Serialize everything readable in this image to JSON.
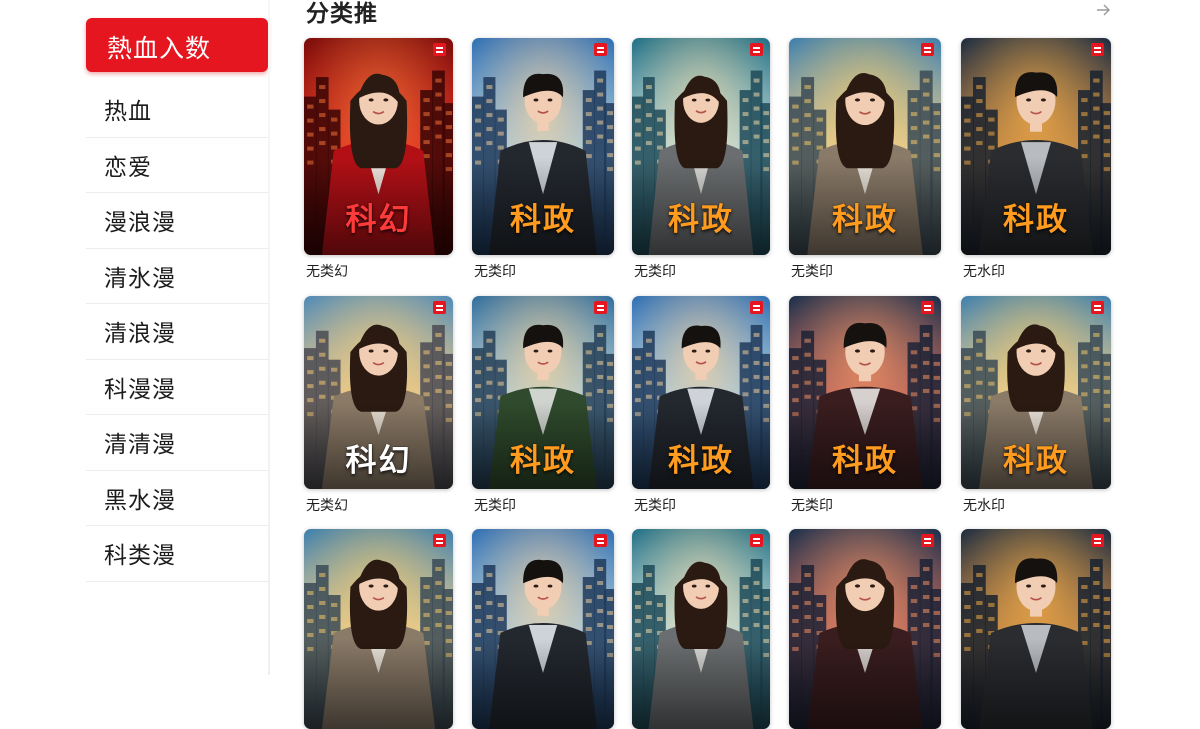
{
  "sidebar": {
    "active_label": "熱血入数",
    "items": [
      "热血",
      "恋爱",
      "漫浪漫",
      "清氷漫",
      "清浪漫",
      "科漫漫",
      "清清漫",
      "黑水漫",
      "科类漫"
    ]
  },
  "main": {
    "section_title": "分类推",
    "more_icon": "arrow-right-icon",
    "rows": [
      [
        {
          "title": "科幻",
          "caption": "无类幻",
          "figure": "woman",
          "theme": "red"
        },
        {
          "title": "科政",
          "caption": "无类印",
          "figure": "man",
          "theme": "blue"
        },
        {
          "title": "科政",
          "caption": "无类印",
          "figure": "woman",
          "theme": "teal"
        },
        {
          "title": "科政",
          "caption": "无类印",
          "figure": "woman",
          "theme": "gold"
        },
        {
          "title": "科政",
          "caption": "无水印",
          "figure": "man",
          "theme": "amber"
        }
      ],
      [
        {
          "title": "科幻",
          "caption": "无类幻",
          "figure": "woman",
          "theme": "warm"
        },
        {
          "title": "科政",
          "caption": "无类印",
          "figure": "man",
          "theme": "green"
        },
        {
          "title": "科政",
          "caption": "无类印",
          "figure": "man",
          "theme": "blue"
        },
        {
          "title": "科政",
          "caption": "无类印",
          "figure": "man",
          "theme": "dusk"
        },
        {
          "title": "科政",
          "caption": "无水印",
          "figure": "woman",
          "theme": "gold"
        }
      ],
      [
        {
          "title": "",
          "caption": "",
          "figure": "woman",
          "theme": "gold"
        },
        {
          "title": "",
          "caption": "",
          "figure": "man",
          "theme": "blue"
        },
        {
          "title": "",
          "caption": "",
          "figure": "woman",
          "theme": "teal"
        },
        {
          "title": "",
          "caption": "",
          "figure": "woman",
          "theme": "dusk"
        },
        {
          "title": "",
          "caption": "",
          "figure": "man",
          "theme": "amber"
        }
      ]
    ]
  },
  "colors": {
    "accent": "#e5161f",
    "title_orange": "#ff9b1f",
    "title_white": "#ffffff"
  }
}
